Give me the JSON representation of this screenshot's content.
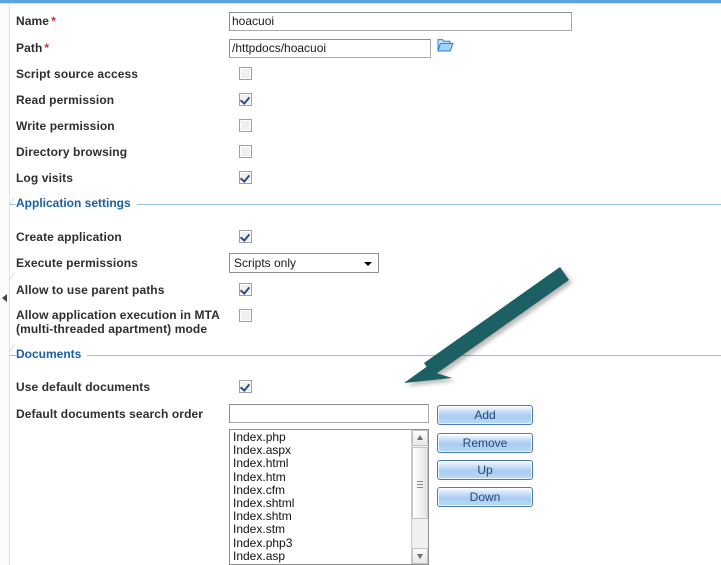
{
  "form": {
    "fields": [
      {
        "label": "Name",
        "required": true,
        "type": "text",
        "value": "hoacuoi"
      },
      {
        "label": "Path",
        "required": true,
        "type": "text",
        "value": "/httpdocs/hoacuoi",
        "icon": "folder-icon"
      },
      {
        "label": "Script source access",
        "required": false,
        "type": "checkbox",
        "checked": false
      },
      {
        "label": "Read permission",
        "required": false,
        "type": "checkbox",
        "checked": true
      },
      {
        "label": "Write permission",
        "required": false,
        "type": "checkbox",
        "checked": false
      },
      {
        "label": "Directory browsing",
        "required": false,
        "type": "checkbox",
        "checked": false
      },
      {
        "label": "Log visits",
        "required": false,
        "type": "checkbox",
        "checked": true
      }
    ]
  },
  "application_settings": {
    "title": "Application settings",
    "create_application": {
      "label": "Create application",
      "checked": true
    },
    "execute_permissions": {
      "label": "Execute permissions",
      "value": "Scripts only"
    },
    "allow_parent_paths": {
      "label": "Allow to use parent paths",
      "checked": true
    },
    "allow_mta": {
      "label_line1": "Allow application execution in MTA",
      "label_line2": "(multi-threaded apartment) mode",
      "checked": false
    }
  },
  "documents": {
    "title": "Documents",
    "use_default_documents": {
      "label": "Use default documents",
      "checked": true
    },
    "search_order": {
      "label": "Default documents search order",
      "value": "",
      "placeholder": ""
    },
    "list_items": [
      "Index.php",
      "Index.aspx",
      "Index.html",
      "Index.htm",
      "Index.cfm",
      "Index.shtml",
      "Index.shtm",
      "Index.stm",
      "Index.php3",
      "Index.asp"
    ],
    "buttons": [
      {
        "label": "Add"
      },
      {
        "label": "Remove"
      },
      {
        "label": "Up"
      },
      {
        "label": "Down"
      }
    ]
  },
  "annotation": {
    "type": "arrow",
    "color": "#1d6063",
    "points_to": "Default documents search order field"
  },
  "colors": {
    "top_rule": "#5fa3e0",
    "section_heading": "#1b5fa8",
    "required_marker": "#cc3333",
    "button_border": "#4a7ebb",
    "annotation_arrow": "#1d6063"
  }
}
